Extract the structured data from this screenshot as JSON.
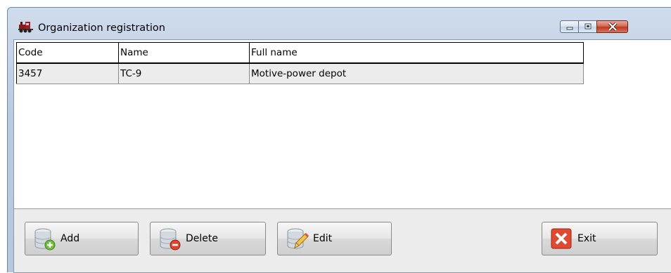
{
  "window": {
    "title": "Organization registration"
  },
  "table": {
    "columns": [
      "Code",
      "Name",
      "Full name"
    ],
    "rows": [
      [
        "3457",
        "TC-9",
        "Motive-power depot"
      ]
    ]
  },
  "buttons": {
    "add": "Add",
    "delete": "Delete",
    "edit": "Edit",
    "exit": "Exit"
  },
  "icons": {
    "app": "locomotive-icon",
    "add": "database-add-icon",
    "delete": "database-delete-icon",
    "edit": "database-edit-icon",
    "exit": "close-x-icon"
  },
  "colors": {
    "title_bar": "#c2d3e8",
    "close_button": "#c7432a",
    "selected_row": "#ececec",
    "button_panel": "#ececec"
  }
}
